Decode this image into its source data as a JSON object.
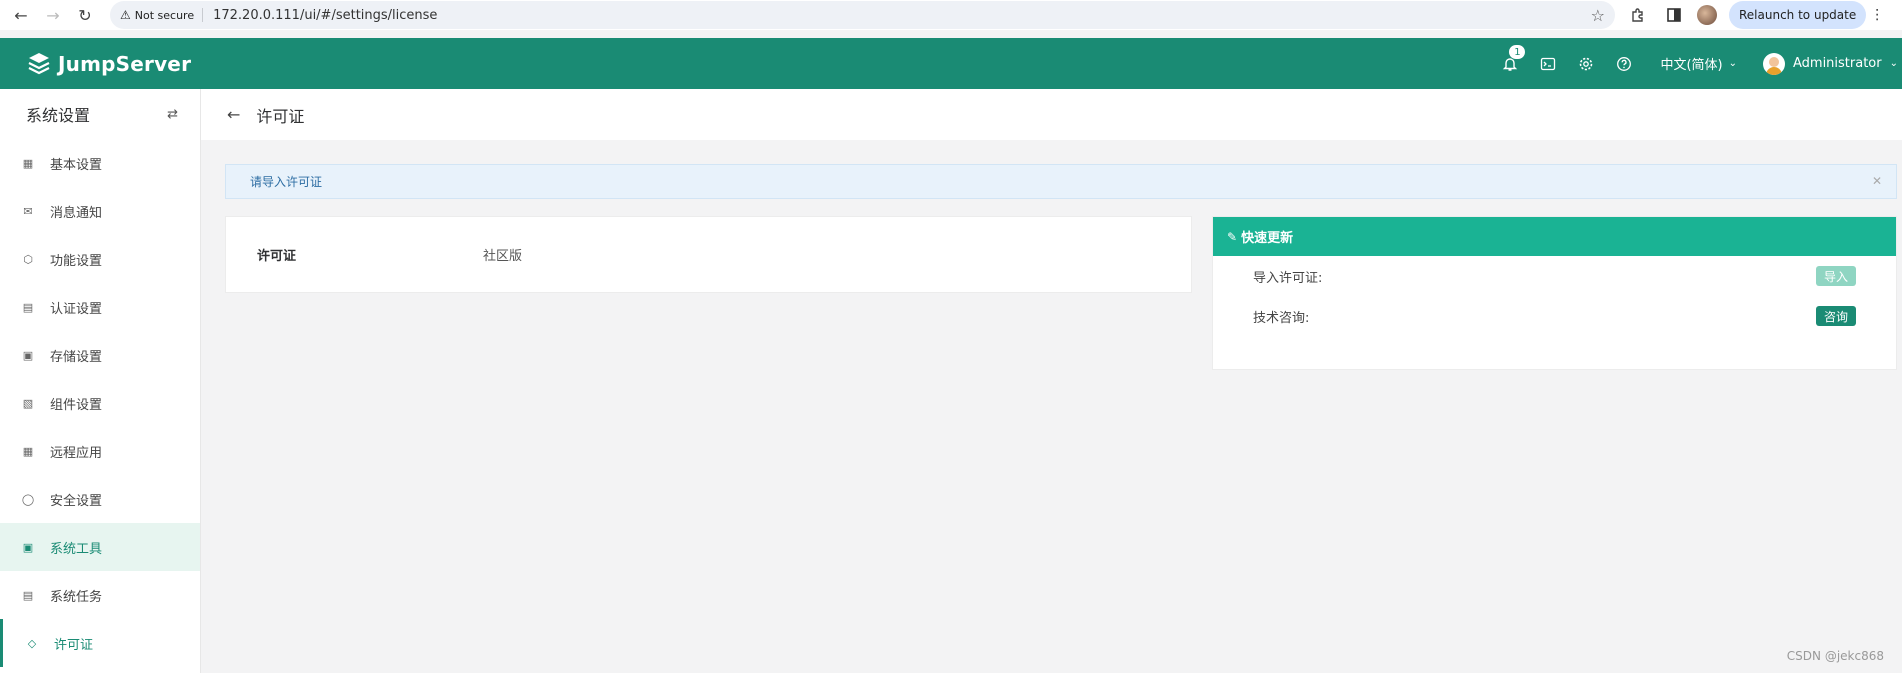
{
  "browser": {
    "security_label": "Not secure",
    "url": "172.20.0.111/ui/#/settings/license",
    "relaunch_label": "Relaunch to update"
  },
  "header": {
    "logo_text": "JumpServer",
    "notification_count": "1",
    "language": "中文(简体)",
    "user_name": "Administrator"
  },
  "sidebar": {
    "title": "系统设置",
    "items": [
      {
        "label": "基本设置",
        "icon": "grid-icon"
      },
      {
        "label": "消息通知",
        "icon": "message-icon"
      },
      {
        "label": "功能设置",
        "icon": "cube-icon"
      },
      {
        "label": "认证设置",
        "icon": "id-card-icon"
      },
      {
        "label": "存储设置",
        "icon": "storage-icon"
      },
      {
        "label": "组件设置",
        "icon": "component-icon"
      },
      {
        "label": "远程应用",
        "icon": "apps-icon"
      },
      {
        "label": "安全设置",
        "icon": "shield-icon"
      },
      {
        "label": "系统工具",
        "icon": "toolbox-icon"
      },
      {
        "label": "系统任务",
        "icon": "task-icon"
      },
      {
        "label": "许可证",
        "icon": "diamond-icon"
      }
    ]
  },
  "page": {
    "title": "许可证",
    "alert": "请导入许可证",
    "license": {
      "label": "许可证",
      "value": "社区版"
    },
    "quick_update": {
      "title": "快速更新",
      "rows": [
        {
          "label": "导入许可证:",
          "button": "导入"
        },
        {
          "label": "技术咨询:",
          "button": "咨询"
        }
      ]
    }
  },
  "watermark": "CSDN @jekc868",
  "colors": {
    "brand": "#1a8b74",
    "panel_header": "#1ab394",
    "alert_bg": "#e8f2fb"
  }
}
